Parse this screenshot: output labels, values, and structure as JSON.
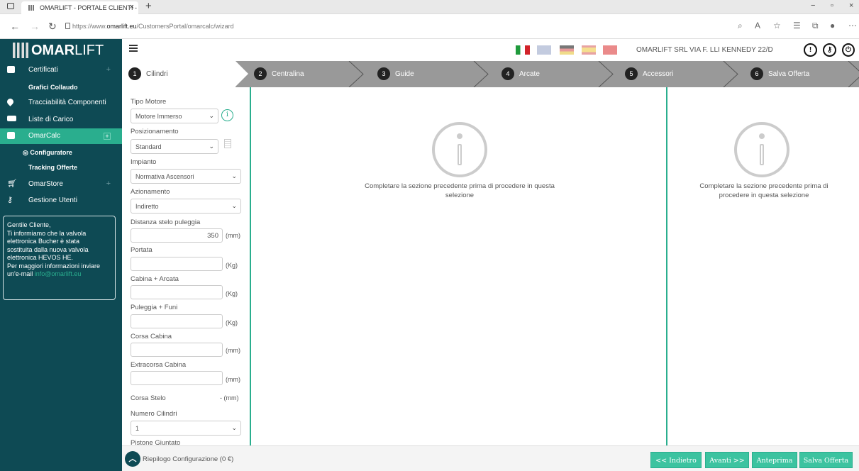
{
  "browser": {
    "tab_title": "OMARLIFT - PORTALE CLIENTI -",
    "url_prefix": "https://www.",
    "url_domain": "omarlift.eu",
    "url_path": "/CustomersPortal/omarcalc/wizard"
  },
  "header": {
    "logo_bold": "OMAR",
    "logo_light": "LIFT",
    "company": "OMARLIFT SRL VIA F. LLI KENNEDY 22/D",
    "flags": [
      "Italian",
      "English",
      "German",
      "Spanish",
      "Turkish"
    ]
  },
  "sidebar": {
    "certificati": "Certificati",
    "grafici": "Grafici Collaudo",
    "tracciabilita": "Tracciabilità Componenti",
    "liste": "Liste di Carico",
    "omarcalc": "OmarCalc",
    "configuratore": "Configuratore",
    "tracking": "Tracking Offerte",
    "omarstore": "OmarStore",
    "gestione": "Gestione Utenti",
    "notice": {
      "l1": "Gentile Cliente,",
      "l2": "Ti informiamo che la valvola",
      "l3": "elettronica Bucher è stata",
      "l4": "sostituita dalla nuova valvola",
      "l5": "elettronica HEVOS HE.",
      "l6": "Per maggiori informazioni inviare",
      "l7": "un'e-mail",
      "email": "info@omarlift.eu"
    }
  },
  "wizard": {
    "steps": [
      {
        "num": "1",
        "label": "Cilindri"
      },
      {
        "num": "2",
        "label": "Centralina"
      },
      {
        "num": "3",
        "label": "Guide"
      },
      {
        "num": "4",
        "label": "Arcate"
      },
      {
        "num": "5",
        "label": "Accessori"
      },
      {
        "num": "6",
        "label": "Salva Offerta"
      }
    ]
  },
  "form": {
    "tipo_motore_label": "Tipo Motore",
    "tipo_motore_value": "Motore Immerso",
    "posizionamento_label": "Posizionamento",
    "posizionamento_value": "Standard",
    "impianto_label": "Impianto",
    "impianto_value": "Normativa Ascensori",
    "azionamento_label": "Azionamento",
    "azionamento_value": "Indiretto",
    "distanza_label": "Distanza stelo puleggia",
    "distanza_value": "350",
    "unit_mm": "(mm)",
    "unit_kg": "(Kg)",
    "portata_label": "Portata",
    "cabina_label": "Cabina + Arcata",
    "puleggia_label": "Puleggia + Funi",
    "corsa_cabina_label": "Corsa Cabina",
    "extracorsa_label": "Extracorsa Cabina",
    "corsa_stelo_label": "Corsa Stelo",
    "corsa_stelo_value": "- (mm)",
    "numero_cilindri_label": "Numero Cilindri",
    "numero_cilindri_value": "1",
    "pistone_label": "Pistone Giuntato"
  },
  "panels": {
    "mid_msg_line1": "Completare la sezione precedente prima di procedere in questa",
    "mid_msg_line2": "selezione",
    "right_msg_line1": "Completare la sezione precedente prima di",
    "right_msg_line2": "procedere in questa selezione"
  },
  "footer": {
    "summary": "Riepilogo Configurazione (0 €)",
    "back": "<< Indietro",
    "next": "Avanti >>",
    "preview": "Anteprima",
    "save": "Salva Offerta"
  },
  "colors": {
    "sidebar": "#0e4a54",
    "accent": "#2aae8e",
    "button": "#3cc3a0",
    "wizard_bg": "#999999"
  }
}
